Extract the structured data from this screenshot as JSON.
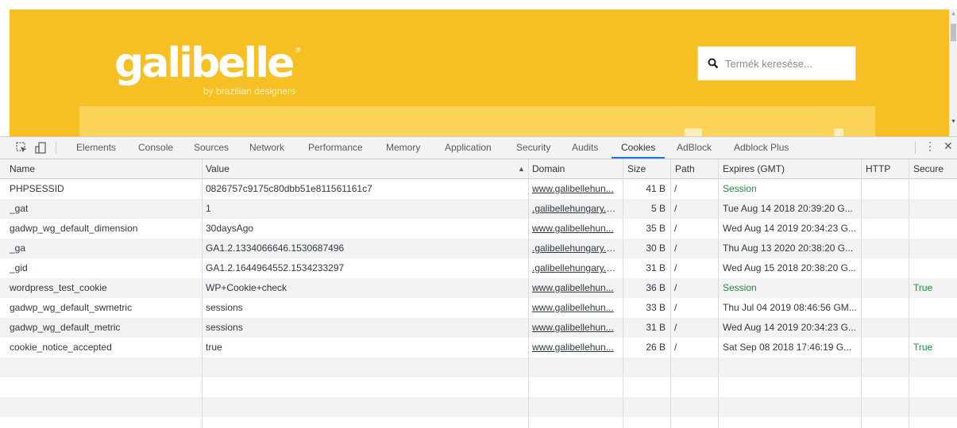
{
  "website": {
    "logo": "galibelle",
    "logo_registered": "®",
    "logo_tagline": "by brazilian designers",
    "search_placeholder": "Termék keresése..."
  },
  "colors": {
    "brand_yellow": "#f6c025",
    "bar_yellow": "#fbd358",
    "session_green": "#1e8e3e",
    "active_tab_blue": "#1a73e8"
  },
  "icons": [
    "inspect-icon",
    "device-toolbar-icon",
    "search-icon",
    "more-options-icon",
    "close-icon"
  ],
  "devtools": {
    "tabs": [
      "Elements",
      "Console",
      "Sources",
      "Network",
      "Performance",
      "Memory",
      "Application",
      "Security",
      "Audits",
      "Cookies",
      "AdBlock",
      "Adblock Plus"
    ],
    "active_tab": "Cookies",
    "menu_glyph": "⋮",
    "close_glyph": "✕"
  },
  "cookies": {
    "columns": [
      "Name",
      "Value",
      "Domain",
      "Size",
      "Path",
      "Expires (GMT)",
      "HTTP",
      "Secure"
    ],
    "sort_indicator": "▲",
    "rows": [
      {
        "name": "PHPSESSID",
        "value": "0826757c9175c80dbb51e811561161c7",
        "domain": "www.galibellehun...",
        "size": "41 B",
        "path": "/",
        "expires": "Session",
        "http": "",
        "secure": ""
      },
      {
        "name": "_gat",
        "value": "1",
        "domain": ".galibellehungary.c...",
        "size": "5 B",
        "path": "/",
        "expires": "Tue Aug 14 2018 20:39:20 G...",
        "http": "",
        "secure": ""
      },
      {
        "name": "gadwp_wg_default_dimension",
        "value": "30daysAgo",
        "domain": "www.galibellehun...",
        "size": "35 B",
        "path": "/",
        "expires": "Wed Aug 14 2019 20:34:23 G...",
        "http": "",
        "secure": ""
      },
      {
        "name": "_ga",
        "value": "GA1.2.1334066646.1530687496",
        "domain": ".galibellehungary.c...",
        "size": "30 B",
        "path": "/",
        "expires": "Thu Aug 13 2020 20:38:20 G...",
        "http": "",
        "secure": ""
      },
      {
        "name": "_gid",
        "value": "GA1.2.1644964552.1534233297",
        "domain": ".galibellehungary.c...",
        "size": "31 B",
        "path": "/",
        "expires": "Wed Aug 15 2018 20:38:20 G...",
        "http": "",
        "secure": ""
      },
      {
        "name": "wordpress_test_cookie",
        "value": "WP+Cookie+check",
        "domain": "www.galibellehun...",
        "size": "36 B",
        "path": "/",
        "expires": "Session",
        "http": "",
        "secure": "True"
      },
      {
        "name": "gadwp_wg_default_swmetric",
        "value": "sessions",
        "domain": "www.galibellehun...",
        "size": "33 B",
        "path": "/",
        "expires": "Thu Jul 04 2019 08:46:56 GM...",
        "http": "",
        "secure": ""
      },
      {
        "name": "gadwp_wg_default_metric",
        "value": "sessions",
        "domain": "www.galibellehun...",
        "size": "31 B",
        "path": "/",
        "expires": "Wed Aug 14 2019 20:34:23 G...",
        "http": "",
        "secure": ""
      },
      {
        "name": "cookie_notice_accepted",
        "value": "true",
        "domain": "www.galibellehun...",
        "size": "26 B",
        "path": "/",
        "expires": "Sat Sep 08 2018 17:46:19 G...",
        "http": "",
        "secure": "True"
      }
    ]
  }
}
